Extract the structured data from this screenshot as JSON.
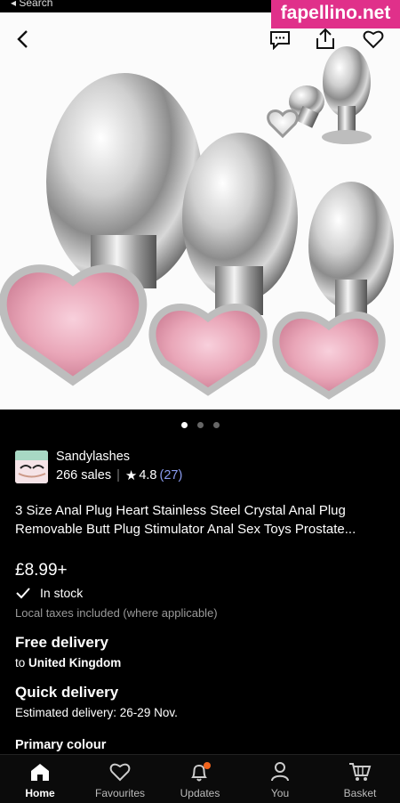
{
  "status": {
    "back_label": "◂ Search"
  },
  "watermark": "fapellino.net",
  "header": {
    "back_icon": "chevron-left-icon",
    "actions": [
      "message-icon",
      "share-icon",
      "heart-icon"
    ]
  },
  "gallery": {
    "image_count": 3,
    "active_index": 0
  },
  "shop": {
    "name": "Sandylashes",
    "sales": "266 sales",
    "rating": "4.8",
    "reviews": "(27)"
  },
  "product": {
    "title": "3 Size Anal Plug Heart Stainless Steel Crystal Anal Plug Removable Butt Plug Stimulator Anal Sex Toys Prostate...",
    "price": "£8.99+",
    "stock": "In stock",
    "taxes_note": "Local taxes included (where applicable)"
  },
  "delivery": {
    "free_heading": "Free delivery",
    "to_prefix": "to",
    "country": "United Kingdom",
    "quick_heading": "Quick delivery",
    "estimate": "Estimated delivery: 26-29 Nov."
  },
  "section": {
    "primary_colour": "Primary colour"
  },
  "tabs": [
    {
      "label": "Home",
      "icon": "home-icon",
      "active": true
    },
    {
      "label": "Favourites",
      "icon": "heart-icon"
    },
    {
      "label": "Updates",
      "icon": "bell-icon"
    },
    {
      "label": "You",
      "icon": "user-icon"
    },
    {
      "label": "Basket",
      "icon": "basket-icon"
    }
  ],
  "colors": {
    "accent_link": "#8a9cf0",
    "notification_dot": "#f1641e",
    "watermark": "#e0308a"
  }
}
